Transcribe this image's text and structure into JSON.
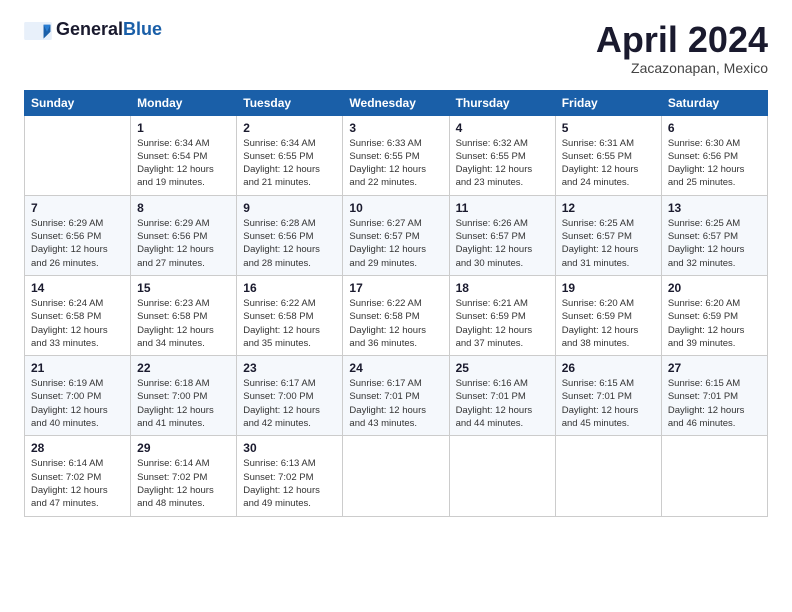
{
  "logo": {
    "general": "General",
    "blue": "Blue"
  },
  "header": {
    "month": "April 2024",
    "location": "Zacazonapan, Mexico"
  },
  "weekdays": [
    "Sunday",
    "Monday",
    "Tuesday",
    "Wednesday",
    "Thursday",
    "Friday",
    "Saturday"
  ],
  "weeks": [
    [
      {
        "day": "",
        "info": ""
      },
      {
        "day": "1",
        "info": "Sunrise: 6:34 AM\nSunset: 6:54 PM\nDaylight: 12 hours\nand 19 minutes."
      },
      {
        "day": "2",
        "info": "Sunrise: 6:34 AM\nSunset: 6:55 PM\nDaylight: 12 hours\nand 21 minutes."
      },
      {
        "day": "3",
        "info": "Sunrise: 6:33 AM\nSunset: 6:55 PM\nDaylight: 12 hours\nand 22 minutes."
      },
      {
        "day": "4",
        "info": "Sunrise: 6:32 AM\nSunset: 6:55 PM\nDaylight: 12 hours\nand 23 minutes."
      },
      {
        "day": "5",
        "info": "Sunrise: 6:31 AM\nSunset: 6:55 PM\nDaylight: 12 hours\nand 24 minutes."
      },
      {
        "day": "6",
        "info": "Sunrise: 6:30 AM\nSunset: 6:56 PM\nDaylight: 12 hours\nand 25 minutes."
      }
    ],
    [
      {
        "day": "7",
        "info": "Sunrise: 6:29 AM\nSunset: 6:56 PM\nDaylight: 12 hours\nand 26 minutes."
      },
      {
        "day": "8",
        "info": "Sunrise: 6:29 AM\nSunset: 6:56 PM\nDaylight: 12 hours\nand 27 minutes."
      },
      {
        "day": "9",
        "info": "Sunrise: 6:28 AM\nSunset: 6:56 PM\nDaylight: 12 hours\nand 28 minutes."
      },
      {
        "day": "10",
        "info": "Sunrise: 6:27 AM\nSunset: 6:57 PM\nDaylight: 12 hours\nand 29 minutes."
      },
      {
        "day": "11",
        "info": "Sunrise: 6:26 AM\nSunset: 6:57 PM\nDaylight: 12 hours\nand 30 minutes."
      },
      {
        "day": "12",
        "info": "Sunrise: 6:25 AM\nSunset: 6:57 PM\nDaylight: 12 hours\nand 31 minutes."
      },
      {
        "day": "13",
        "info": "Sunrise: 6:25 AM\nSunset: 6:57 PM\nDaylight: 12 hours\nand 32 minutes."
      }
    ],
    [
      {
        "day": "14",
        "info": "Sunrise: 6:24 AM\nSunset: 6:58 PM\nDaylight: 12 hours\nand 33 minutes."
      },
      {
        "day": "15",
        "info": "Sunrise: 6:23 AM\nSunset: 6:58 PM\nDaylight: 12 hours\nand 34 minutes."
      },
      {
        "day": "16",
        "info": "Sunrise: 6:22 AM\nSunset: 6:58 PM\nDaylight: 12 hours\nand 35 minutes."
      },
      {
        "day": "17",
        "info": "Sunrise: 6:22 AM\nSunset: 6:58 PM\nDaylight: 12 hours\nand 36 minutes."
      },
      {
        "day": "18",
        "info": "Sunrise: 6:21 AM\nSunset: 6:59 PM\nDaylight: 12 hours\nand 37 minutes."
      },
      {
        "day": "19",
        "info": "Sunrise: 6:20 AM\nSunset: 6:59 PM\nDaylight: 12 hours\nand 38 minutes."
      },
      {
        "day": "20",
        "info": "Sunrise: 6:20 AM\nSunset: 6:59 PM\nDaylight: 12 hours\nand 39 minutes."
      }
    ],
    [
      {
        "day": "21",
        "info": "Sunrise: 6:19 AM\nSunset: 7:00 PM\nDaylight: 12 hours\nand 40 minutes."
      },
      {
        "day": "22",
        "info": "Sunrise: 6:18 AM\nSunset: 7:00 PM\nDaylight: 12 hours\nand 41 minutes."
      },
      {
        "day": "23",
        "info": "Sunrise: 6:17 AM\nSunset: 7:00 PM\nDaylight: 12 hours\nand 42 minutes."
      },
      {
        "day": "24",
        "info": "Sunrise: 6:17 AM\nSunset: 7:01 PM\nDaylight: 12 hours\nand 43 minutes."
      },
      {
        "day": "25",
        "info": "Sunrise: 6:16 AM\nSunset: 7:01 PM\nDaylight: 12 hours\nand 44 minutes."
      },
      {
        "day": "26",
        "info": "Sunrise: 6:15 AM\nSunset: 7:01 PM\nDaylight: 12 hours\nand 45 minutes."
      },
      {
        "day": "27",
        "info": "Sunrise: 6:15 AM\nSunset: 7:01 PM\nDaylight: 12 hours\nand 46 minutes."
      }
    ],
    [
      {
        "day": "28",
        "info": "Sunrise: 6:14 AM\nSunset: 7:02 PM\nDaylight: 12 hours\nand 47 minutes."
      },
      {
        "day": "29",
        "info": "Sunrise: 6:14 AM\nSunset: 7:02 PM\nDaylight: 12 hours\nand 48 minutes."
      },
      {
        "day": "30",
        "info": "Sunrise: 6:13 AM\nSunset: 7:02 PM\nDaylight: 12 hours\nand 49 minutes."
      },
      {
        "day": "",
        "info": ""
      },
      {
        "day": "",
        "info": ""
      },
      {
        "day": "",
        "info": ""
      },
      {
        "day": "",
        "info": ""
      }
    ]
  ]
}
